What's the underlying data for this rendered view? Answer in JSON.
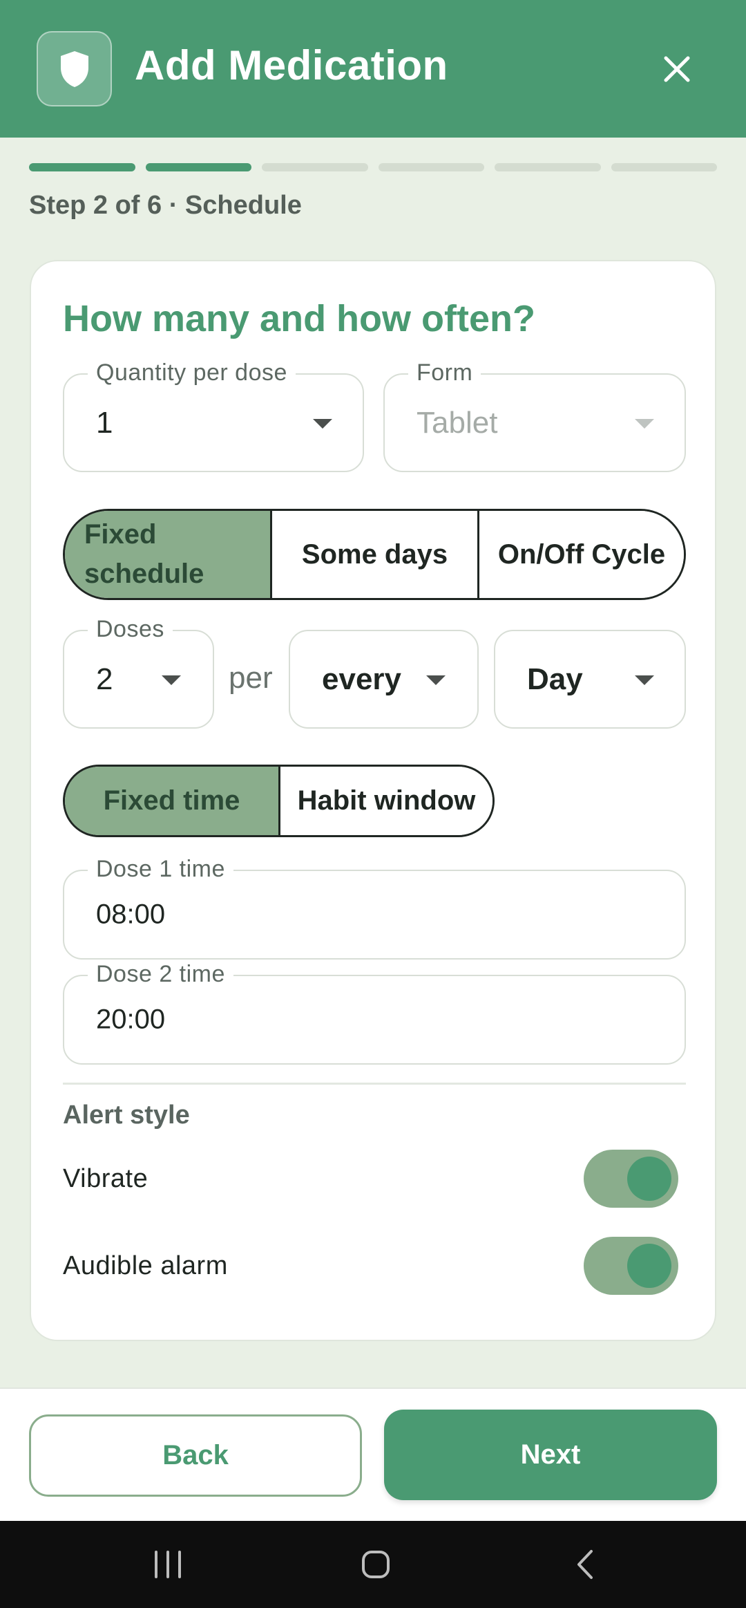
{
  "header": {
    "title": "Add Medication",
    "logo_icon": "shield-icon",
    "close_icon": "close-icon"
  },
  "progress": {
    "current_step": 2,
    "total_steps": 6,
    "label": "Step 2 of 6 · Schedule"
  },
  "card": {
    "title": "How many and how often?",
    "quantity": {
      "label": "Quantity per dose",
      "value": "1"
    },
    "form": {
      "label": "Form",
      "value": "Tablet"
    },
    "schedule_type": {
      "options": [
        "Fixed\nschedule",
        "Some days",
        "On/Off Cycle"
      ],
      "selected_index": 0
    },
    "doses": {
      "label": "Doses",
      "value": "2"
    },
    "per_text": "per",
    "every": {
      "value": "every"
    },
    "period": {
      "value": "Day"
    },
    "time_mode": {
      "options": [
        "Fixed time",
        "Habit window"
      ],
      "selected_index": 0
    },
    "dose_times": [
      {
        "label": "Dose 1 time",
        "value": "08:00"
      },
      {
        "label": "Dose 2 time",
        "value": "20:00"
      }
    ],
    "alert": {
      "section_label": "Alert style",
      "vibrate": {
        "label": "Vibrate",
        "on": true
      },
      "audible": {
        "label": "Audible alarm",
        "on": true
      }
    }
  },
  "footer": {
    "back_label": "Back",
    "next_label": "Next"
  },
  "system_nav": {
    "icons": [
      "recents-icon",
      "home-icon",
      "back-nav-icon"
    ]
  },
  "colors": {
    "primary": "#4a9a72",
    "selected_segment": "#8aad8c",
    "background": "#e9f0e5"
  }
}
